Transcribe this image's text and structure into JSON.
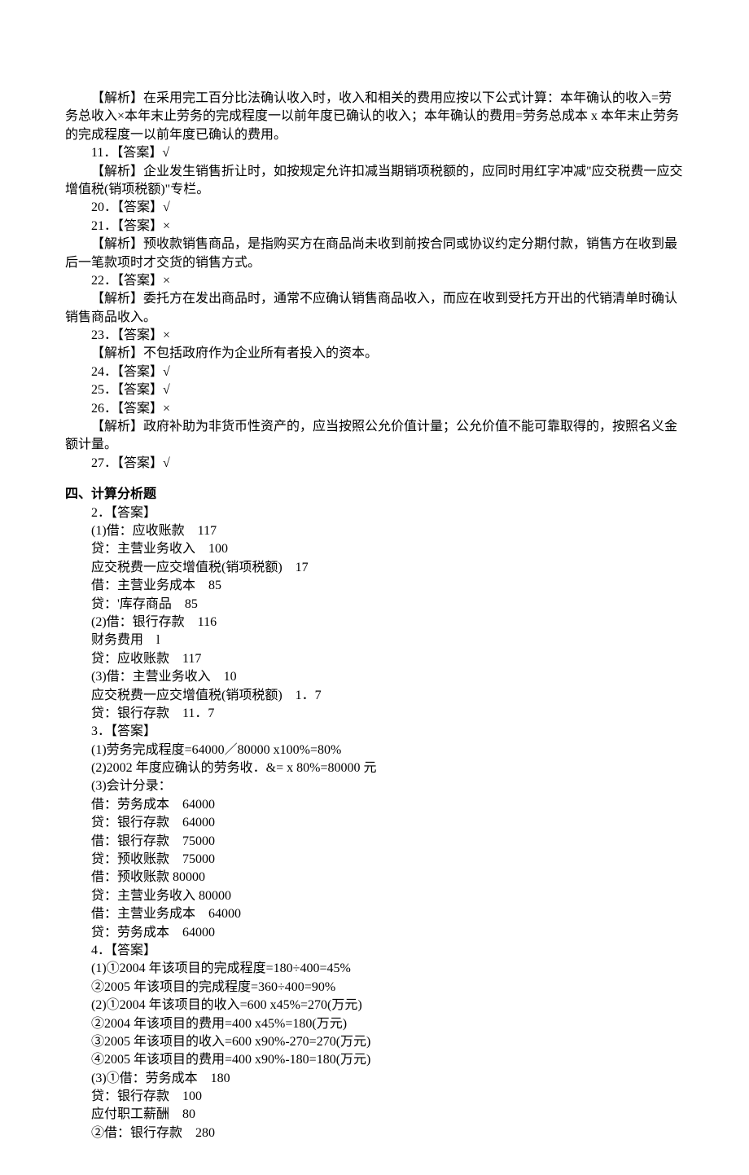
{
  "lines": [
    {
      "cls": "para",
      "text": "【解析】在采用完工百分比法确认收入时，收入和相关的费用应按以下公式计算：本年确认的收入=劳务总收入×本年末止劳务的完成程度一以前年度已确认的收入；本年确认的费用=劳务总成本 x 本年末止劳务的完成程度一以前年度已确认的费用。",
      "wrap": true
    },
    {
      "cls": "answer-line",
      "text": "11．【答案】√"
    },
    {
      "cls": "para",
      "text": "【解析】企业发生销售折让时，如按规定允许扣减当期销项税额的，应同时用红字冲减\"应交税费一应交增值税(销项税额)\"专栏。",
      "wrap": true
    },
    {
      "cls": "answer-line",
      "text": "20．【答案】√"
    },
    {
      "cls": "answer-line",
      "text": "21．【答案】×"
    },
    {
      "cls": "para",
      "text": "【解析】预收款销售商品，是指购买方在商品尚未收到前按合同或协议约定分期付款，销售方在收到最后一笔款项时才交货的销售方式。",
      "wrap": true
    },
    {
      "cls": "answer-line",
      "text": "22．【答案】×"
    },
    {
      "cls": "para",
      "text": "【解析】委托方在发出商品时，通常不应确认销售商品收入，而应在收到受托方开出的代销清单时确认销售商品收入。",
      "wrap": true
    },
    {
      "cls": "answer-line",
      "text": "23．【答案】×"
    },
    {
      "cls": "para",
      "text": "【解析】不包括政府作为企业所有者投入的资本。"
    },
    {
      "cls": "answer-line",
      "text": "24．【答案】√"
    },
    {
      "cls": "answer-line",
      "text": "25．【答案】√"
    },
    {
      "cls": "answer-line",
      "text": "26．【答案】×"
    },
    {
      "cls": "para",
      "text": "【解析】政府补助为非货币性资产的，应当按照公允价值计量；公允价值不能可靠取得的，按照名义金额计量。",
      "wrap": true
    },
    {
      "cls": "answer-line",
      "text": "27．【答案】√"
    },
    {
      "cls": "section-title",
      "text": "四、计算分析题"
    },
    {
      "cls": "sub-line",
      "text": "2．【答案】"
    },
    {
      "cls": "sub-line",
      "text": "(1)借：应收账款　117"
    },
    {
      "cls": "sub-line",
      "text": "贷：主营业务收入　100"
    },
    {
      "cls": "sub-line",
      "text": "应交税费一应交增值税(销项税额)　17"
    },
    {
      "cls": "sub-line",
      "text": "借：主营业务成本　85"
    },
    {
      "cls": "sub-line",
      "text": "贷：'库存商品　85"
    },
    {
      "cls": "sub-line",
      "text": "(2)借：银行存款　116"
    },
    {
      "cls": "sub-line",
      "text": "财务费用　l"
    },
    {
      "cls": "sub-line",
      "text": "贷：应收账款　117"
    },
    {
      "cls": "sub-line",
      "text": "(3)借：主营业务收入　10"
    },
    {
      "cls": "sub-line",
      "text": "应交税费一应交增值税(销项税额)　1．7"
    },
    {
      "cls": "sub-line",
      "text": "贷：银行存款　11．7"
    },
    {
      "cls": "sub-line",
      "text": "3．【答案】"
    },
    {
      "cls": "sub-line",
      "text": "(1)劳务完成程度=64000／80000 x100%=80%"
    },
    {
      "cls": "sub-line",
      "text": "(2)2002 年度应确认的劳务收．&= x 80%=80000 元"
    },
    {
      "cls": "sub-line",
      "text": "(3)会计分录："
    },
    {
      "cls": "sub-line",
      "text": "借：劳务成本　64000"
    },
    {
      "cls": "sub-line",
      "text": "贷：银行存款　64000"
    },
    {
      "cls": "sub-line",
      "text": "借：银行存款　75000"
    },
    {
      "cls": "sub-line",
      "text": "贷：预收账款　75000"
    },
    {
      "cls": "sub-line",
      "text": "借：预收账款 80000"
    },
    {
      "cls": "sub-line",
      "text": "贷：主营业务收入 80000"
    },
    {
      "cls": "sub-line",
      "text": "借：主营业务成本　64000"
    },
    {
      "cls": "sub-line",
      "text": "贷：劳务成本　64000"
    },
    {
      "cls": "sub-line",
      "text": "4．【答案】"
    },
    {
      "cls": "sub-line",
      "text": "(1)①2004 年该项目的完成程度=180÷400=45%"
    },
    {
      "cls": "sub-line",
      "text": "②2005 年该项目的完成程度=360÷400=90%"
    },
    {
      "cls": "sub-line",
      "text": "(2)①2004 年该项目的收入=600 x45%=270(万元)"
    },
    {
      "cls": "sub-line",
      "text": "②2004 年该项目的费用=400 x45%=180(万元)"
    },
    {
      "cls": "sub-line",
      "text": "③2005 年该项目的收入=600 x90%-270=270(万元)"
    },
    {
      "cls": "sub-line",
      "text": "④2005 年该项目的费用=400 x90%-180=180(万元)"
    },
    {
      "cls": "sub-line",
      "text": "(3)①借：劳务成本　180"
    },
    {
      "cls": "sub-line",
      "text": "贷：银行存款　100"
    },
    {
      "cls": "sub-line",
      "text": "应付职工薪酬　80"
    },
    {
      "cls": "sub-line",
      "text": "②借：银行存款　280"
    }
  ]
}
